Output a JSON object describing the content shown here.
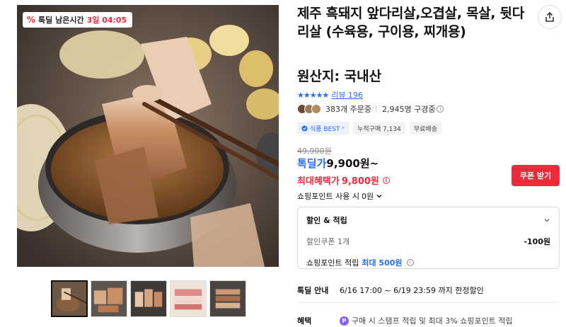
{
  "gallery": {
    "timer_badge": {
      "icon": "percent-icon",
      "label": "톡딜 남은시간",
      "value": "3일 04:05"
    },
    "thumbnail_count": 5,
    "active_thumbnail": 1
  },
  "product": {
    "title": "제주 흑돼지 앞다리살,오겹살, 목살, 뒷다리살 (수육용, 구이용, 찌개용)",
    "origin": "원산지: 국내산",
    "rating": {
      "stars": "★★★★★",
      "review_label": "리뷰 196"
    },
    "buyers": {
      "orders": "383개 주문중",
      "subscribers": "2,945명 구경중"
    },
    "tags": {
      "best": "식품 BEST",
      "best_arrow": "›",
      "purchases": "누적구매 7,134",
      "shipping": "무료배송"
    }
  },
  "price": {
    "original": "49,900원",
    "deal_label": "톡딜가",
    "deal_value": "9,900원~",
    "max_label": "최대혜택가",
    "max_value": "9,800원",
    "coupon_button": "쿠폰 받기",
    "points_use": "쇼핑포인트 사용 시",
    "points_use_value": "0원"
  },
  "discount": {
    "header": "할인 & 적립",
    "coupon_label": "할인쿠폰 1개",
    "coupon_amount": "-100원",
    "points_label": "쇼핑포인트 적립",
    "points_max": "최대 500원"
  },
  "deal_info": {
    "label": "톡딜 안내",
    "value": "6/16 17:00 ~ 6/19 23:59 까지 한정할인"
  },
  "benefit": {
    "label": "혜택",
    "badge": "P",
    "value": "구매 시 스탬프 적립 및 최대 3% 쇼핑포인트 적립"
  },
  "colors": {
    "accent_red": "#f0283c",
    "accent_blue": "#2a6df4",
    "point_purple": "#8a5cf6"
  }
}
